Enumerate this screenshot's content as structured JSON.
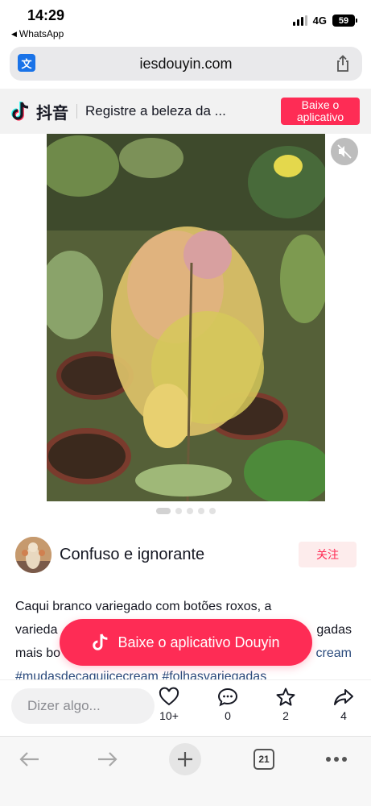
{
  "status_bar": {
    "time": "14:29",
    "back_app": "WhatsApp",
    "network": "4G",
    "battery": "59"
  },
  "url_bar": {
    "domain": "iesdouyin.com",
    "translate_icon": "translate-icon",
    "share_icon": "share-icon"
  },
  "douyin_header": {
    "brand": "抖音",
    "slogan": "Registre a beleza da ...",
    "download_button": "Baixe o aplicativo"
  },
  "video": {
    "mute_icon": "speaker-muted-icon",
    "page_count": 5,
    "active_page": 1
  },
  "author": {
    "name": "Confuso e ignorante",
    "follow_label": "关注"
  },
  "description": {
    "line1": "Caqui branco variegado com botões roxos, a",
    "line2_start": "varieda",
    "line2_end": "gadas",
    "line3_start": "mais bo",
    "line3_end": "cream",
    "hashtags": "#mudasdecaquiicecream #folhasvariegadas"
  },
  "open_app_button": {
    "label": "Baixe o aplicativo Douyin"
  },
  "action_bar": {
    "comment_placeholder": "Dizer algo...",
    "likes": "10+",
    "comments": "0",
    "favorites": "2",
    "shares": "4"
  },
  "browser_toolbar": {
    "tab_count": "21"
  },
  "colors": {
    "accent": "#fe2c55",
    "hashtag": "#2a4a7c"
  }
}
